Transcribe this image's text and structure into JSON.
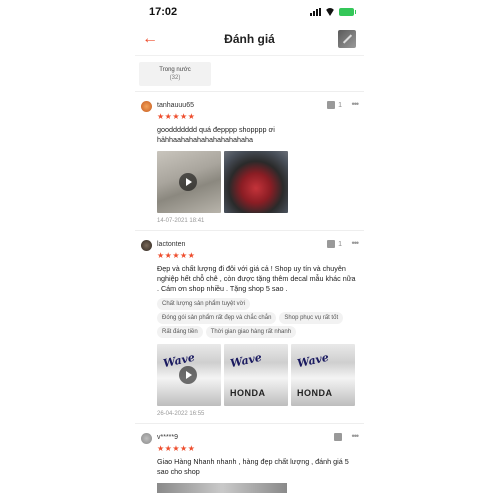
{
  "status_bar": {
    "time": "17:02"
  },
  "header": {
    "title": "Đánh giá",
    "back_icon": "arrow-left-icon",
    "accent": "#ee4d2d"
  },
  "filter": {
    "label": "Trong nước",
    "count": "(32)"
  },
  "reviews": [
    {
      "username": "tanhauuu65",
      "likes": "1",
      "stars": "★★★★★",
      "content": "gooddddddd quá đepppp shopppp ơi hảhhaahahahahahahahahaha",
      "date": "14-07-2021 18:41"
    },
    {
      "username": "lactonten",
      "likes": "1",
      "stars": "★★★★★",
      "content": "Đẹp và chất lượng đi đôi với giá cả ! Shop uy tín và chuyên nghiệp hết chỗ chê , còn được tặng thêm decal mẫu khác nữa . Cám ơn shop nhiều . Tặng shop 5 sao .",
      "tags": [
        "Chất lượng sản phẩm tuyệt vời",
        "Đóng gói sản phẩm rất đẹp và chắc chắn",
        "Shop phục vụ rất tốt",
        "Rất đáng tiền",
        "Thời gian giao hàng rất nhanh"
      ],
      "decal_text": "Wave",
      "decal_sub": "HONDA",
      "date": "26-04-2022 16:55"
    },
    {
      "username": "v*****9",
      "stars": "★★★★★",
      "content": "Giao Hàng Nhanh nhanh , hàng đẹp chất lượng , đánh giá 5 sao cho shop"
    }
  ]
}
